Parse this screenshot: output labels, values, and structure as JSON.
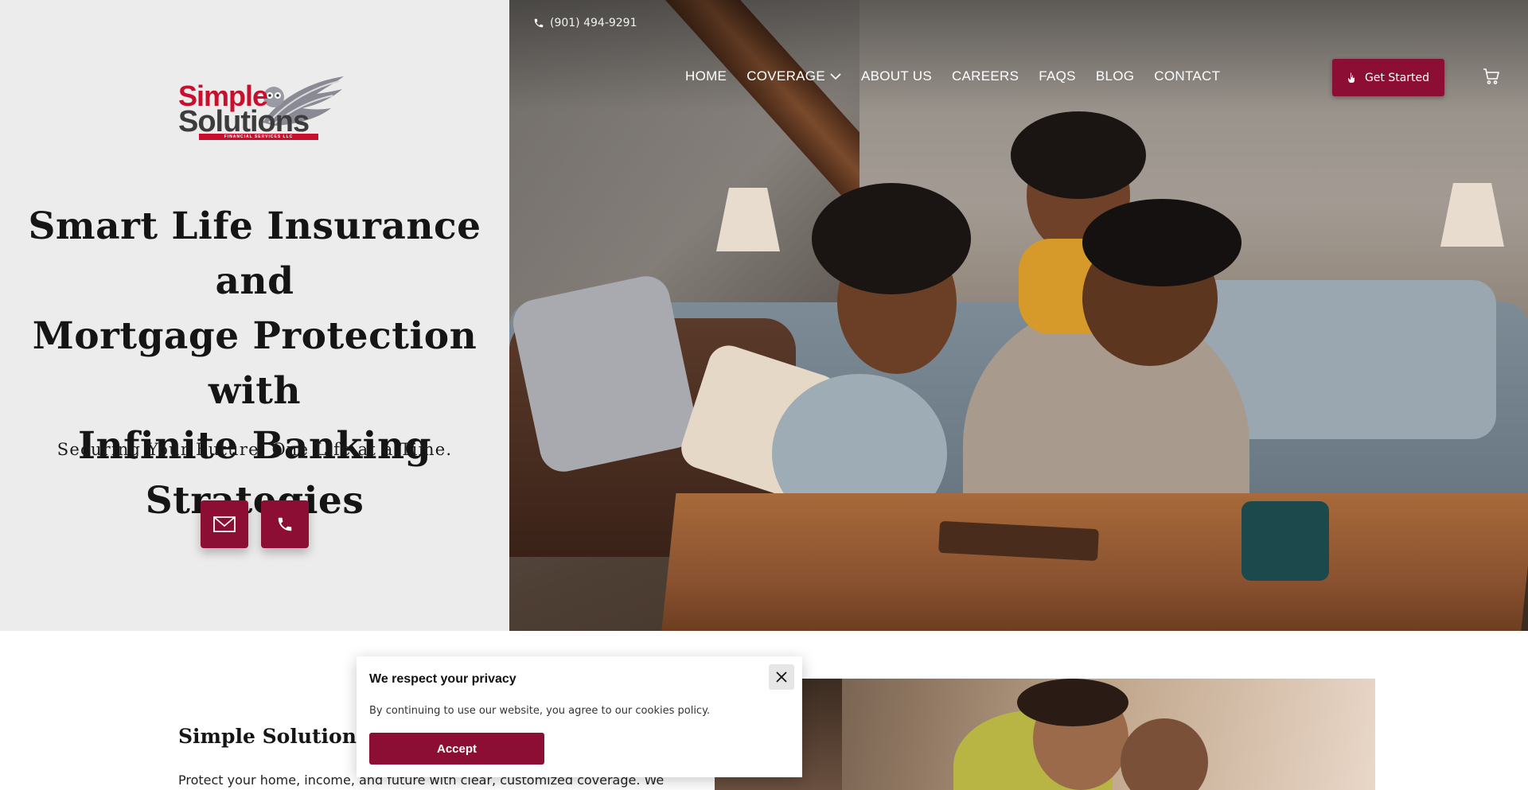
{
  "header": {
    "phone": "(901) 494-9291",
    "logo": {
      "word1": "Simple",
      "word2": "Solutions",
      "tagline": "FINANCIAL SERVICES LLC"
    },
    "nav": [
      {
        "label": "HOME"
      },
      {
        "label": "COVERAGE"
      },
      {
        "label": "ABOUT US"
      },
      {
        "label": "CAREERS"
      },
      {
        "label": "FAQS"
      },
      {
        "label": "BLOG"
      },
      {
        "label": "CONTACT"
      }
    ],
    "cta_label": "Get Started"
  },
  "hero": {
    "title_lines": [
      "Smart Life Insurance and",
      "Mortgage Protection with",
      "Infinite Banking",
      "Strategies"
    ],
    "subtitle": "Securing Your Future, One Life at a Time."
  },
  "section": {
    "heading": "Simple Solutions Fo",
    "text": "Protect your home, income, and future with clear, customized coverage. We"
  },
  "cookie": {
    "title": "We respect your privacy",
    "text": "By continuing to use our website, you agree to our cookies policy.",
    "accept_label": "Accept"
  },
  "colors": {
    "brand": "#8d0e35",
    "logo_red": "#c8102e",
    "hero_left_bg": "#ececec"
  },
  "icons": [
    "phone-icon",
    "chevron-down-icon",
    "hand-icon",
    "cart-icon",
    "email-icon",
    "close-icon",
    "wing-icon"
  ]
}
